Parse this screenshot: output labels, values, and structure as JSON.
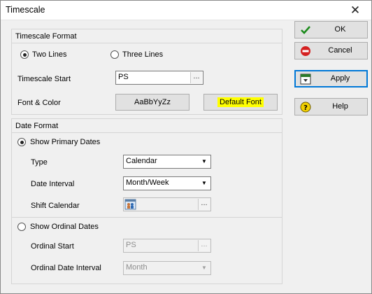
{
  "window": {
    "title": "Timescale",
    "close_glyph": "✕"
  },
  "timescale_format": {
    "header": "Timescale Format",
    "two_lines": "Two Lines",
    "three_lines": "Three Lines",
    "selected": "Two Lines",
    "start_label": "Timescale Start",
    "start_value": "PS",
    "font_color_label": "Font & Color",
    "font_sample": "AaBbYyZz",
    "default_font": "Default Font",
    "default_font_highlight": "#ffff00"
  },
  "date_format": {
    "header": "Date Format",
    "show_primary": "Show Primary Dates",
    "type_label": "Type",
    "type_value": "Calendar",
    "interval_label": "Date Interval",
    "interval_value": "Month/Week",
    "shift_label": "Shift Calendar",
    "show_ordinal": "Show Ordinal Dates",
    "ordinal_start_label": "Ordinal Start",
    "ordinal_start_value": "PS",
    "ordinal_interval_label": "Ordinal Date Interval",
    "ordinal_interval_value": "Month"
  },
  "buttons": {
    "ok": "OK",
    "cancel": "Cancel",
    "apply": "Apply",
    "help": "Help",
    "dots": "..."
  },
  "icons": {
    "ok": "check-icon",
    "cancel": "no-entry-icon",
    "apply": "apply-icon",
    "help": "help-icon",
    "shift_calendar": "calendar-people-icon"
  },
  "colors": {
    "ok_check": "#1a8a1a",
    "cancel_red": "#d42020",
    "help_yellow": "#f2d000"
  }
}
